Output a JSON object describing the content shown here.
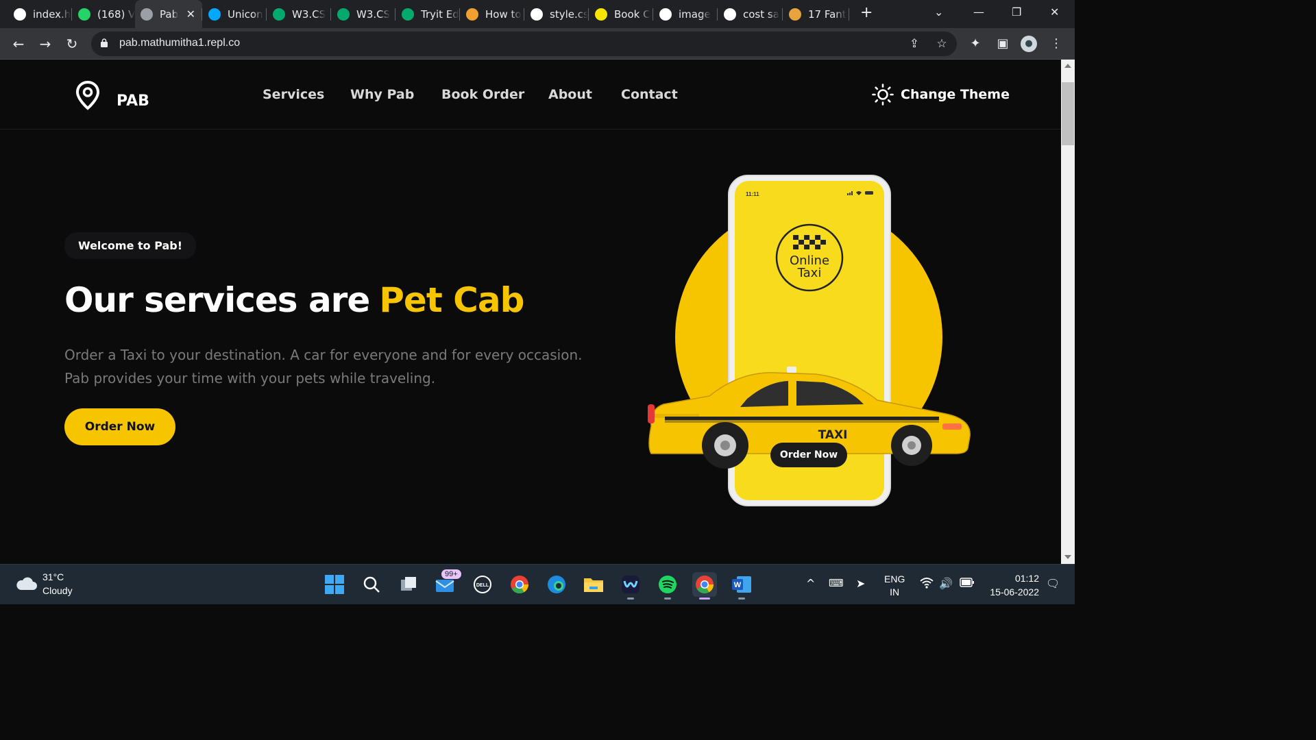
{
  "browser": {
    "tabs": [
      {
        "title": "index.h",
        "icon": "replit-icon",
        "color": "#ffffff"
      },
      {
        "title": "(168) V",
        "icon": "whatsapp-icon",
        "color": "#25d366"
      },
      {
        "title": "Pab",
        "icon": "globe-icon",
        "color": "#9aa0a6",
        "active": true
      },
      {
        "title": "Unicon",
        "icon": "unicons-icon",
        "color": "#00a8ff"
      },
      {
        "title": "W3.CS",
        "icon": "w3schools-icon",
        "color": "#04aa6d"
      },
      {
        "title": "W3.CS",
        "icon": "w3schools-icon",
        "color": "#04aa6d"
      },
      {
        "title": "Tryit Ed",
        "icon": "w3schools-icon",
        "color": "#04aa6d"
      },
      {
        "title": "How to",
        "icon": "codepen-icon",
        "color": "#f0a030"
      },
      {
        "title": "style.cs",
        "icon": "replit-icon",
        "color": "#ffffff"
      },
      {
        "title": "Book C",
        "icon": "dot-icon",
        "color": "#f7e600"
      },
      {
        "title": "image",
        "icon": "google-icon",
        "color": "#ffffff"
      },
      {
        "title": "cost sa",
        "icon": "google-icon",
        "color": "#ffffff"
      },
      {
        "title": "17 Fant",
        "icon": "font-icon",
        "color": "#e8a33c"
      }
    ],
    "url": "pab.mathumitha1.repl.co"
  },
  "site": {
    "logo_text": "PAB",
    "nav": [
      "Services",
      "Why Pab",
      "Book Order",
      "About",
      "Contact"
    ],
    "theme_label": "Change Theme",
    "badge": "Welcome to Pab!",
    "title_main": "Our services are",
    "title_accent": "Pet Cab",
    "description_line1": "Order a Taxi to your destination. A car for everyone and for every occasion.",
    "description_line2": "Pab provides your time with your pets while traveling.",
    "cta": "Order Now",
    "accent_color": "#f7c400",
    "illustration": {
      "phone_time": "11:11",
      "circle_text_1": "Online",
      "circle_text_2": "Taxi",
      "taxi_text": "TAXI",
      "phone_button": "Order Now"
    }
  },
  "taskbar": {
    "weather_temp": "31°C",
    "weather_desc": "Cloudy",
    "mail_badge": "99+",
    "lang_1": "ENG",
    "lang_2": "IN",
    "time": "01:12",
    "date": "15-06-2022"
  }
}
